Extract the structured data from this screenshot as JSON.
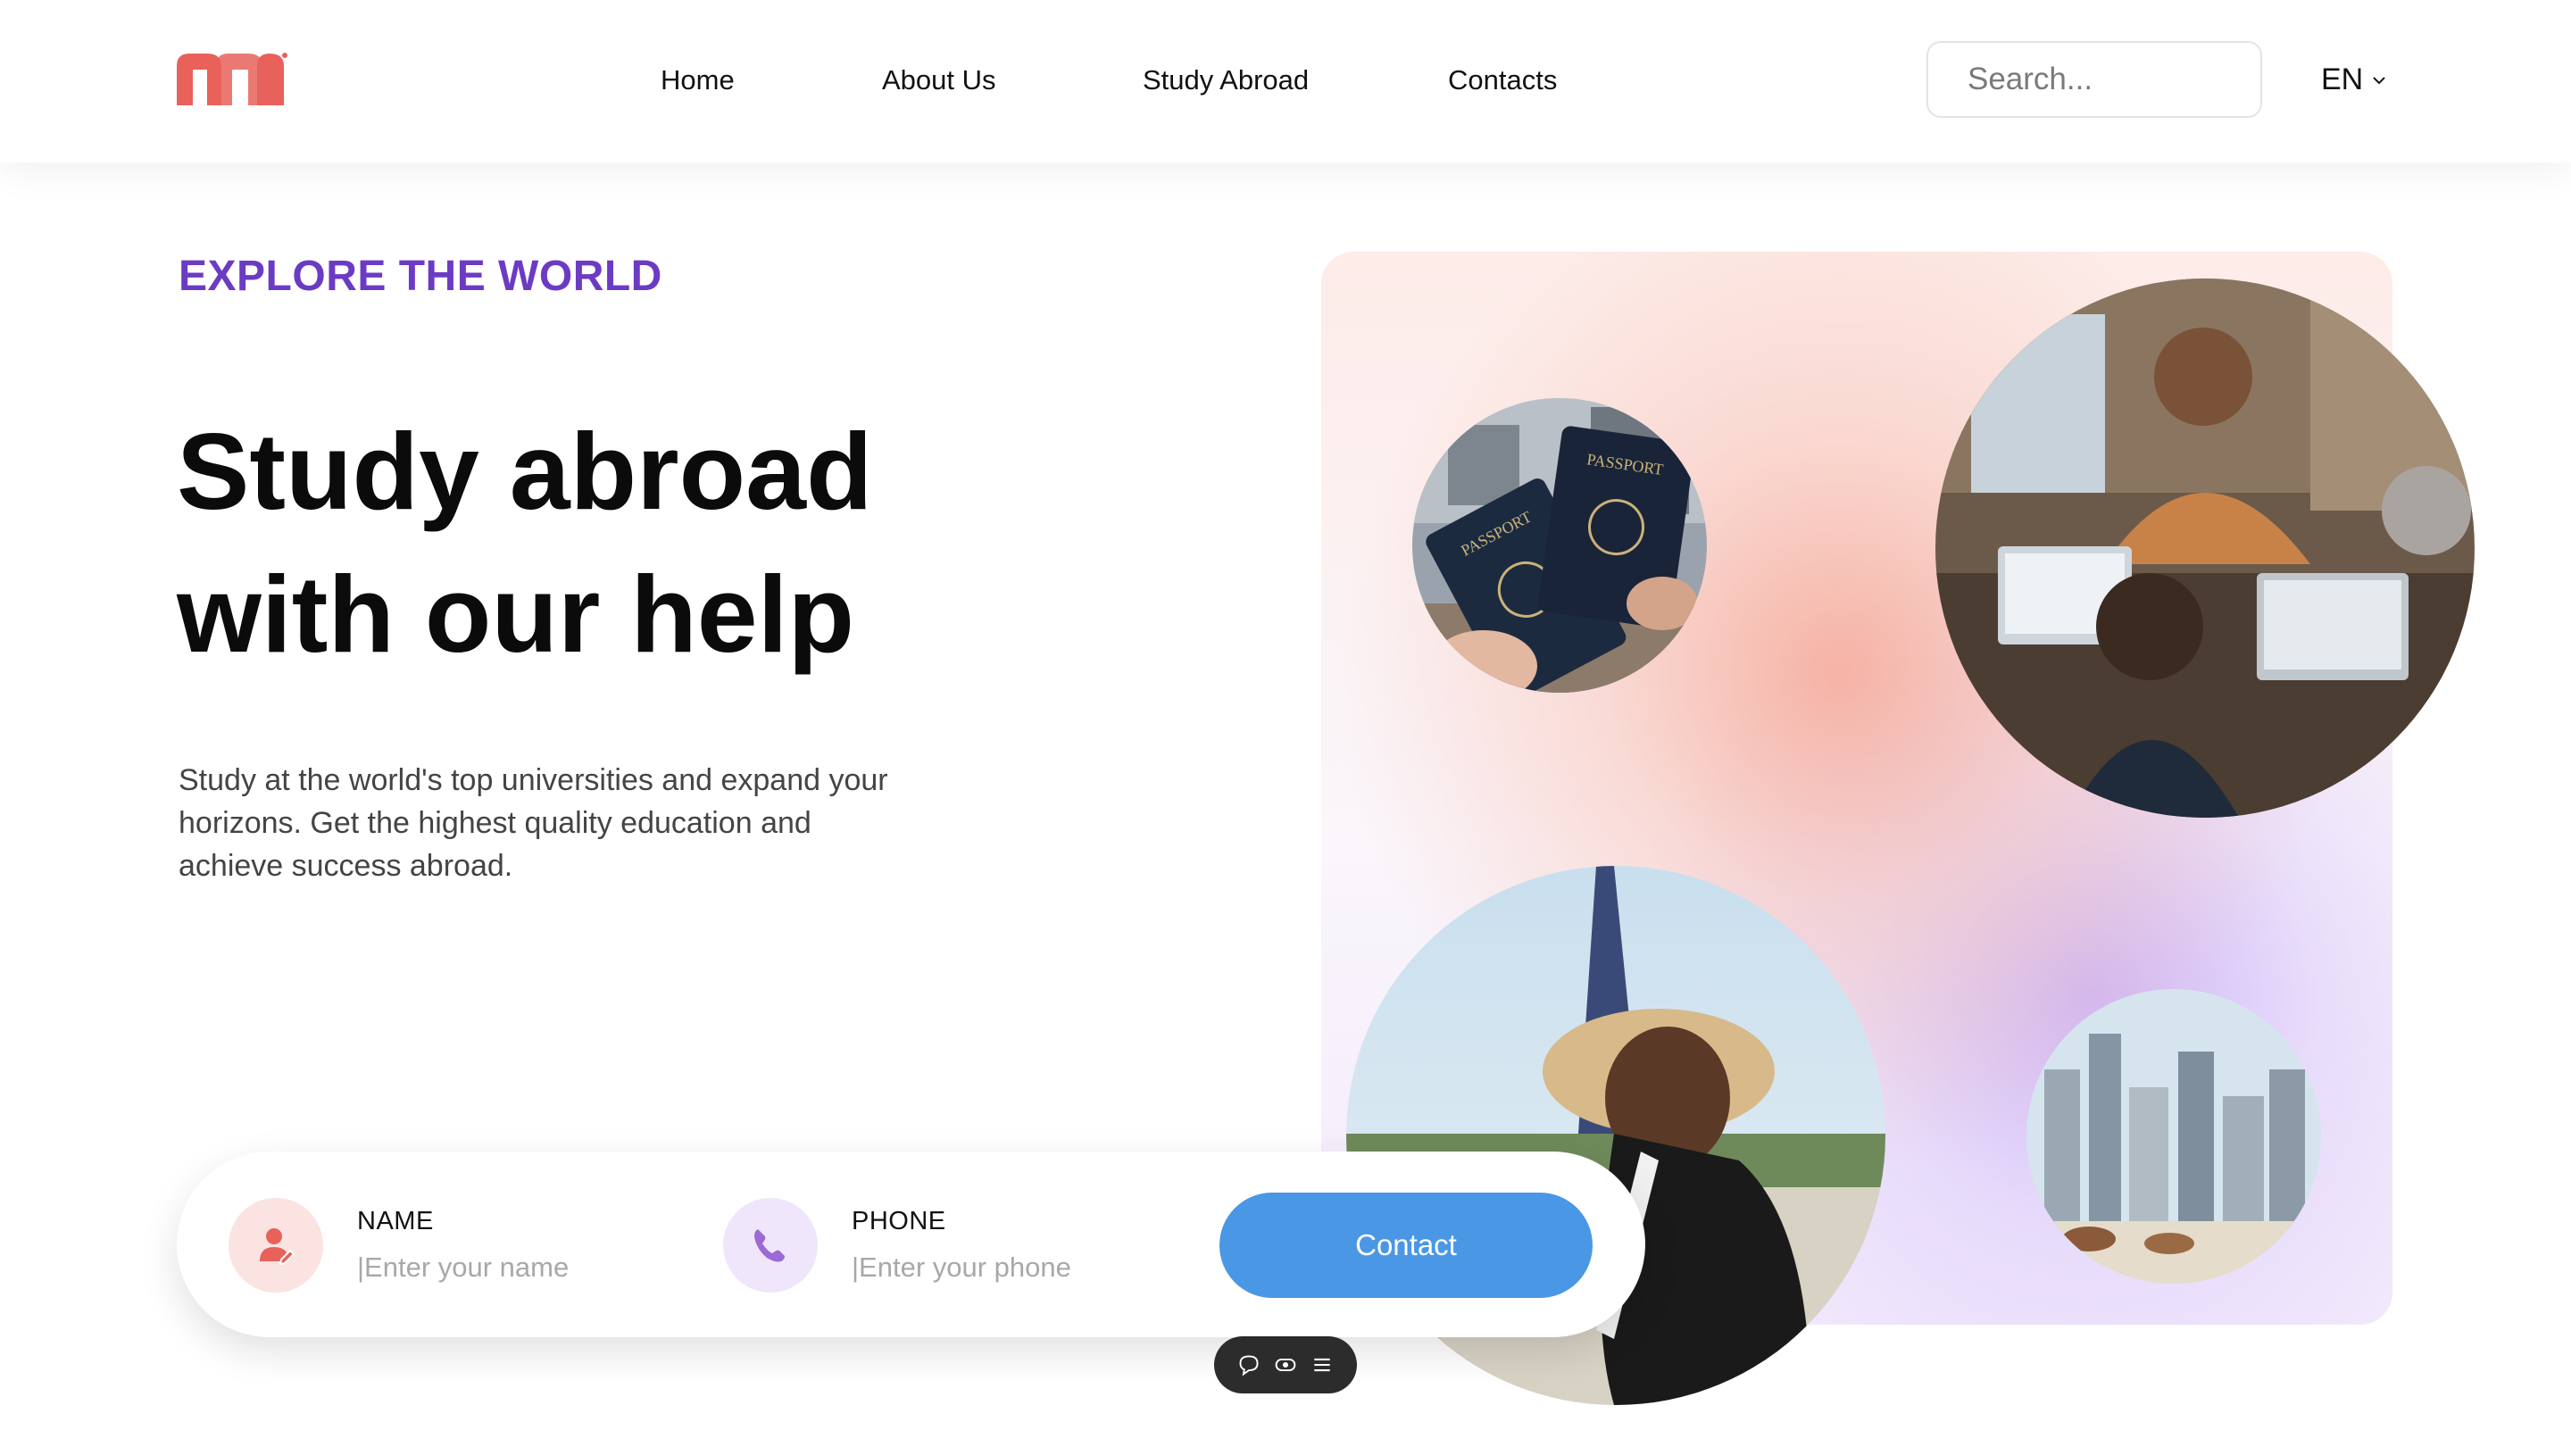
{
  "header": {
    "nav": [
      {
        "label": "Home"
      },
      {
        "label": "About Us"
      },
      {
        "label": "Study Abroad"
      },
      {
        "label": "Contacts"
      }
    ],
    "search": {
      "placeholder": "Search..."
    },
    "language": "EN",
    "logo_icon": "m-logo-icon"
  },
  "hero": {
    "eyebrow": "EXPLORE THE WORLD",
    "headline_line1": "Study abroad",
    "headline_line2": "with our help",
    "description": "Study at the world's top universities and expand your horizons. Get the highest quality education and achieve success abroad."
  },
  "form": {
    "name_label": "NAME",
    "name_placeholder": "|Enter your name",
    "phone_label": "PHONE",
    "phone_placeholder": "|Enter your phone",
    "submit_label": "Contact"
  },
  "colors": {
    "brand_red": "#e8615a",
    "accent_purple": "#6c3bc4",
    "button_blue": "#4a97e6"
  },
  "toolbar": {
    "icons": [
      "chat-icon",
      "eye-icon",
      "menu-icon"
    ]
  }
}
